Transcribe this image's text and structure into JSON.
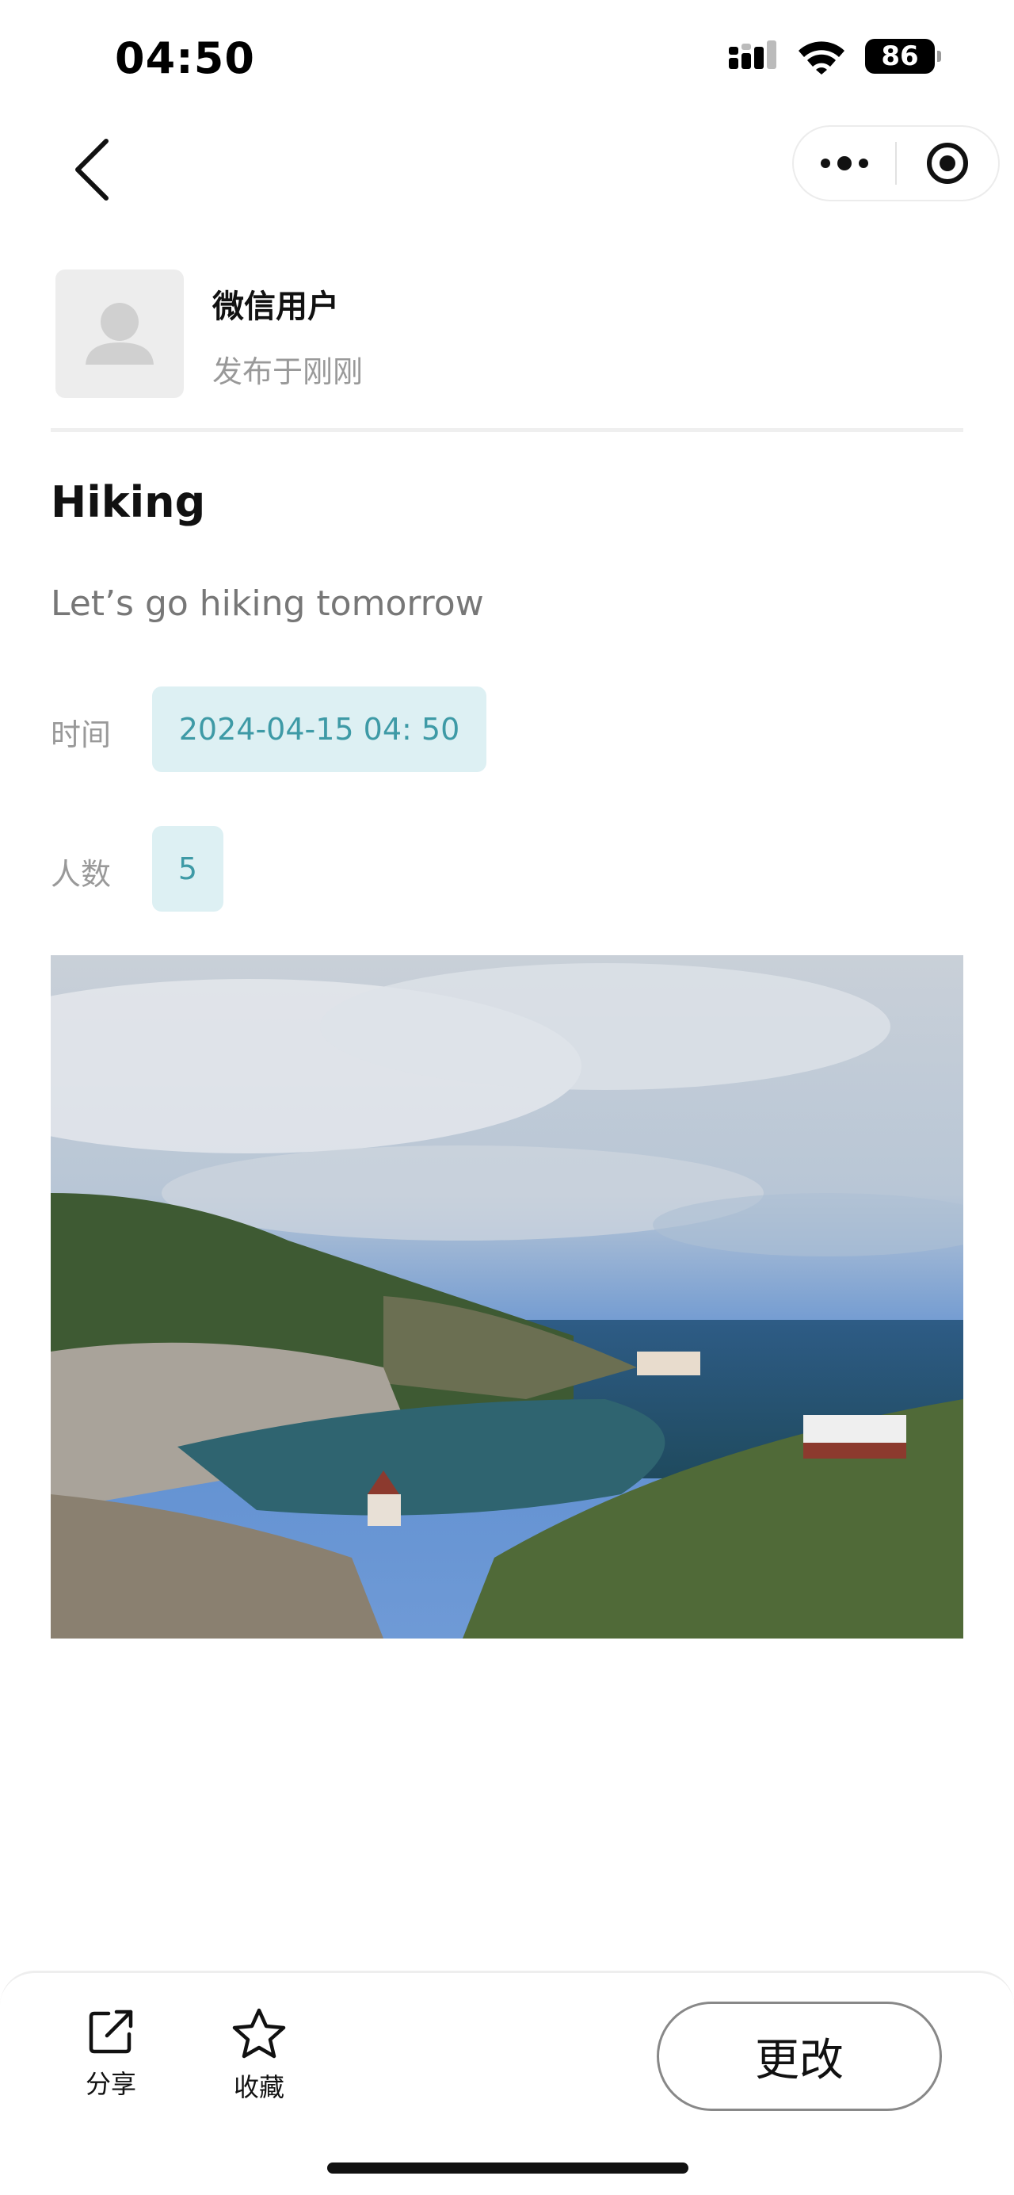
{
  "status_bar": {
    "time": "04:50",
    "battery": "86"
  },
  "nav": {
    "back_icon": "chevron-left-icon",
    "more_icon": "more-dots-icon",
    "close_icon": "target-circle-icon"
  },
  "author": {
    "name": "微信用户",
    "posted": "发布于刚刚"
  },
  "post": {
    "title": "Hiking",
    "description": "Let’s go hiking tomorrow",
    "time_label": "时间",
    "time_value": "2024-04-15 04: 50",
    "people_label": "人数",
    "people_value": "5"
  },
  "bottom_bar": {
    "share_label": "分享",
    "favorite_label": "收藏",
    "edit_label": "更改"
  },
  "colors": {
    "chip_bg": "#ddf0f3",
    "chip_text": "#3e9aa6"
  }
}
